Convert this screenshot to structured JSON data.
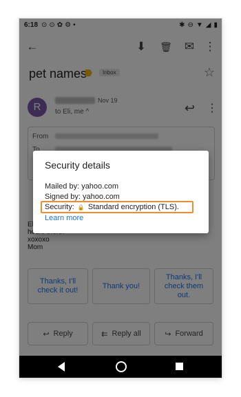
{
  "status": {
    "time": "6:18"
  },
  "toolbar": {
    "back": "←",
    "archive": "⬇",
    "delete": "🗑",
    "mail": "✉",
    "more": "⋮"
  },
  "email": {
    "subject": "pet names",
    "label": "Inbox",
    "avatar_letter": "R",
    "date": "Nov 19",
    "to_line": "to Eli, me ^",
    "from_label": "From",
    "to_label": "To",
    "body_lines": [
      "El",
      "hours there.",
      "xoxoxo",
      "Mom"
    ]
  },
  "smart_replies": [
    "Thanks, I'll check it out!",
    "Thank you!",
    "Thanks, I'll check them out."
  ],
  "actions": {
    "reply": "Reply",
    "reply_all": "Reply all",
    "forward": "Forward"
  },
  "dialog": {
    "title": "Security details",
    "mailed_by": "Mailed by: yahoo.com",
    "signed_by": "Signed by: yahoo.com",
    "security_label": "Security:",
    "security_value": "Standard encryption (TLS).",
    "learn_more": "Learn more"
  }
}
